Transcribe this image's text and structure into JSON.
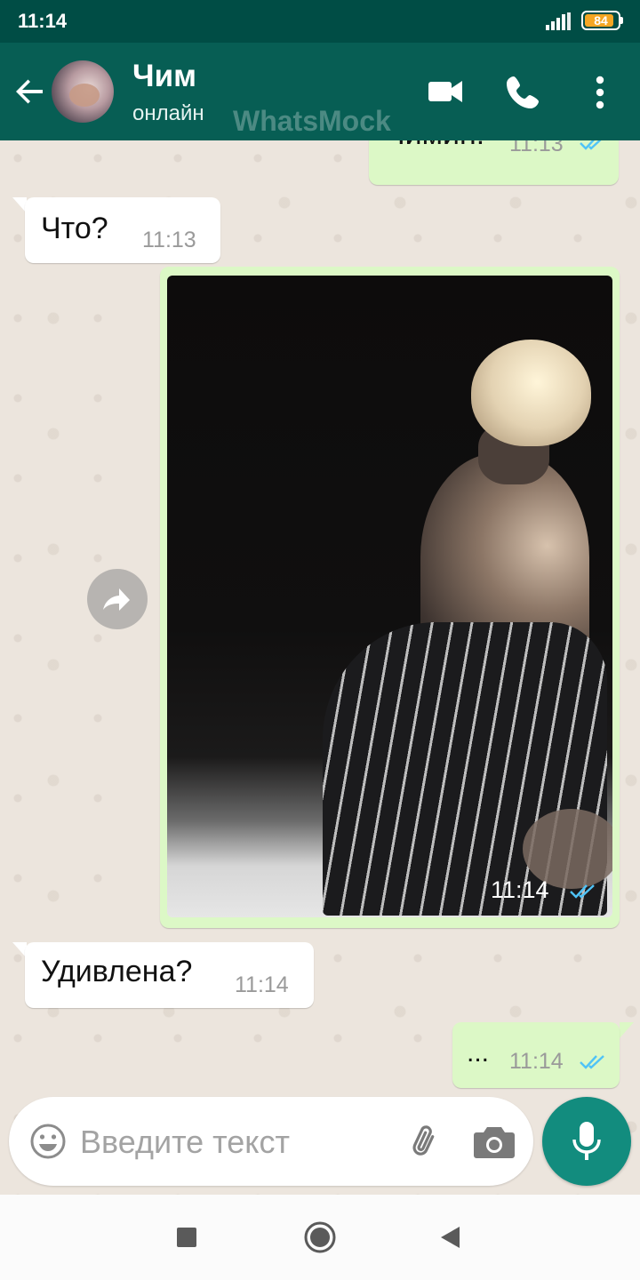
{
  "status_bar": {
    "time": "11:14",
    "battery": "84",
    "battery_color": "#f5a623"
  },
  "header": {
    "back_icon": "arrow-left-icon",
    "contact_name": "Чим",
    "contact_status": "онлайн",
    "watermark": "WhatsMock",
    "icons": [
      "video-call-icon",
      "phone-call-icon",
      "more-vert-icon"
    ],
    "background": "#075e54"
  },
  "messages": [
    {
      "direction": "out",
      "text": "Чимин!",
      "time": "11:13",
      "read": true
    },
    {
      "direction": "in",
      "text": "Что?",
      "time": "11:13"
    },
    {
      "direction": "out",
      "type": "image",
      "time": "11:14",
      "read": true
    },
    {
      "direction": "in",
      "text": "Удивлена?",
      "time": "11:14"
    },
    {
      "direction": "out",
      "text": "...",
      "time": "11:14",
      "read": true
    }
  ],
  "composer": {
    "placeholder": "Введите текст",
    "icons": [
      "emoji-icon",
      "attach-icon",
      "camera-icon",
      "mic-icon"
    ]
  },
  "colors": {
    "outgoing_bubble": "#dcf8c6",
    "incoming_bubble": "#ffffff",
    "chat_background": "#ece5dd",
    "read_ticks": "#4fc3f7",
    "accent": "#128c7e"
  },
  "nav_bar": {
    "icons": [
      "recents-icon",
      "home-icon",
      "back-icon"
    ]
  }
}
